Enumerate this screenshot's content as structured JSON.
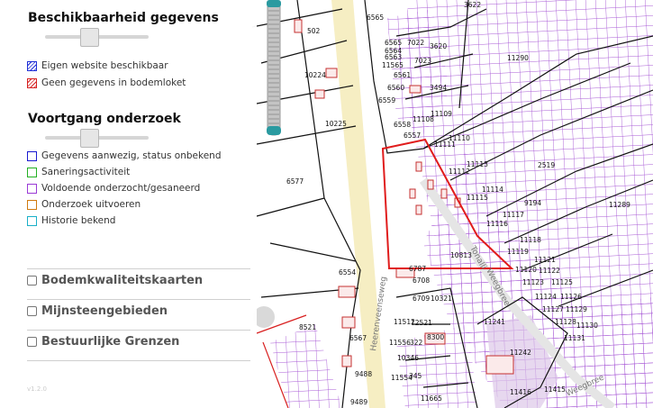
{
  "panel": {
    "heading1": "Beschikbaarheid gegevens",
    "legend1": [
      {
        "label": "Eigen website beschikbaar",
        "color": "#1f2fd6",
        "hatch": true
      },
      {
        "label": "Geen gegevens in bodemloket",
        "color": "#d62020",
        "hatch": true
      }
    ],
    "heading2": "Voortgang onderzoek",
    "legend2": [
      {
        "label": "Gegevens aanwezig, status onbekend",
        "color": "#1a1ad0"
      },
      {
        "label": "Saneringsactiviteit",
        "color": "#22b022"
      },
      {
        "label": "Voldoende onderzocht/gesaneerd",
        "color": "#9a3ad6"
      },
      {
        "label": "Onderzoek uitvoeren",
        "color": "#d07a10"
      },
      {
        "label": "Historie bekend",
        "color": "#1ab0c8"
      }
    ],
    "layers": [
      {
        "label": "Bodemkwaliteitskaarten",
        "checked": false
      },
      {
        "label": "Mijnsteengebieden",
        "checked": false
      },
      {
        "label": "Bestuurlijke Grenzen",
        "checked": false
      }
    ],
    "version": "v1.2.0"
  },
  "map": {
    "street_labels": [
      "Heerenveenseweg",
      "Tonalli",
      "Weegbree",
      "Weegbree"
    ],
    "parcel_labels": [
      "3622",
      "6565",
      "502",
      "6565",
      "7022",
      "3620",
      "6564",
      "6563",
      "7023",
      "11290",
      "11565",
      "6561",
      "10224",
      "6560",
      "3494",
      "6559",
      "11109",
      "10225",
      "11108",
      "6558",
      "6557",
      "11110",
      "11111",
      "11112",
      "11113",
      "2519",
      "6577",
      "11114",
      "11115",
      "9194",
      "11289",
      "11116",
      "11117",
      "11118",
      "10813",
      "11119",
      "6787",
      "11120",
      "11121",
      "6554",
      "6708",
      "11122",
      "11123",
      "11125",
      "6709",
      "10321",
      "11124",
      "11126",
      "11127",
      "11129",
      "8521",
      "11512",
      "12521",
      "11128",
      "11130",
      "8300",
      "6567",
      "11556",
      "322",
      "11131",
      "11241",
      "10346",
      "11242",
      "9488",
      "11554",
      "345",
      "11416",
      "11415",
      "9489",
      "11665"
    ]
  }
}
